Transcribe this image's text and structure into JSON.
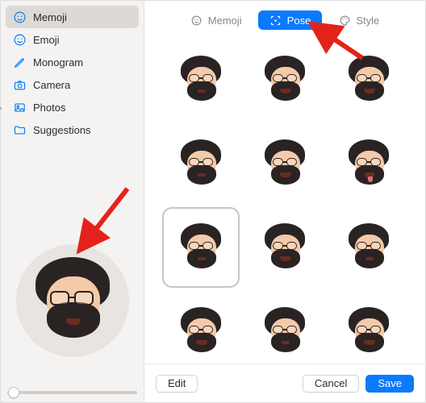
{
  "sidebar": {
    "items": [
      {
        "label": "Memoji"
      },
      {
        "label": "Emoji"
      },
      {
        "label": "Monogram"
      },
      {
        "label": "Camera"
      },
      {
        "label": "Photos"
      },
      {
        "label": "Suggestions"
      }
    ],
    "selected_index": 0
  },
  "tabs": {
    "items": [
      {
        "label": "Memoji"
      },
      {
        "label": "Pose"
      },
      {
        "label": "Style"
      }
    ],
    "active_index": 1
  },
  "pose_grid": {
    "rows": 4,
    "cols": 3,
    "selected_index": 6
  },
  "footer": {
    "edit_label": "Edit",
    "cancel_label": "Cancel",
    "save_label": "Save"
  },
  "colors": {
    "accent": "#0a7aff",
    "sidebar_bg": "#f5f3f2",
    "selection_bg": "#dcd9d7"
  }
}
